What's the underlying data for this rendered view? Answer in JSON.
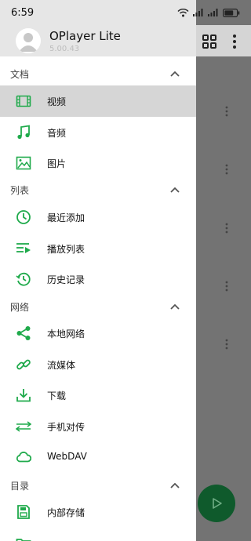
{
  "status_bar": {
    "time": "6:59",
    "battery_level": 0.75
  },
  "header": {
    "app_name": "OPlayer Lite",
    "version": "5.00.43"
  },
  "sections": [
    {
      "label": "文档",
      "items": [
        {
          "label": "视频",
          "icon": "video-icon",
          "selected": true
        },
        {
          "label": "音频",
          "icon": "music-note-icon"
        },
        {
          "label": "图片",
          "icon": "image-icon"
        }
      ]
    },
    {
      "label": "列表",
      "items": [
        {
          "label": "最近添加",
          "icon": "clock-icon"
        },
        {
          "label": "播放列表",
          "icon": "playlist-icon"
        },
        {
          "label": "历史记录",
          "icon": "history-icon"
        }
      ]
    },
    {
      "label": "网络",
      "items": [
        {
          "label": "本地网络",
          "icon": "share-icon"
        },
        {
          "label": "流媒体",
          "icon": "link-icon"
        },
        {
          "label": "下载",
          "icon": "download-icon"
        },
        {
          "label": "手机对传",
          "icon": "transfer-icon"
        },
        {
          "label": "WebDAV",
          "icon": "cloud-icon"
        }
      ]
    },
    {
      "label": "目录",
      "items": [
        {
          "label": "内部存储",
          "icon": "sd-card-icon"
        }
      ]
    }
  ],
  "colors": {
    "accent": "#1faa4b",
    "scrim": "#737373",
    "selected_bg": "#d6d6d6",
    "fab": "#0f5a2c"
  }
}
